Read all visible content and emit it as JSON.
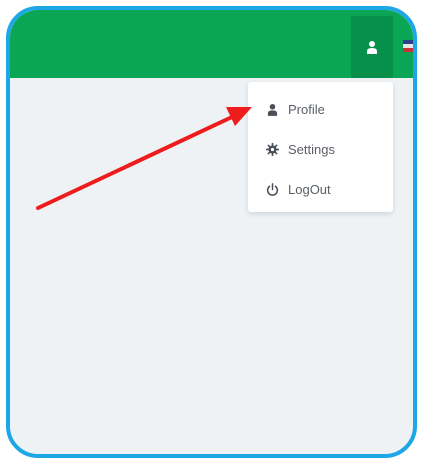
{
  "header": {
    "user_icon": "user-icon",
    "flag_icon": "flag-icon",
    "colors": {
      "bar": "#0aa655",
      "button": "#07904a"
    }
  },
  "user_menu": {
    "items": [
      {
        "label": "Profile",
        "icon": "user-icon"
      },
      {
        "label": "Settings",
        "icon": "gear-icon"
      },
      {
        "label": "LogOut",
        "icon": "power-icon"
      }
    ]
  },
  "annotation": {
    "arrow_color": "#ee1c1c",
    "frame_color": "#1da7e6"
  }
}
